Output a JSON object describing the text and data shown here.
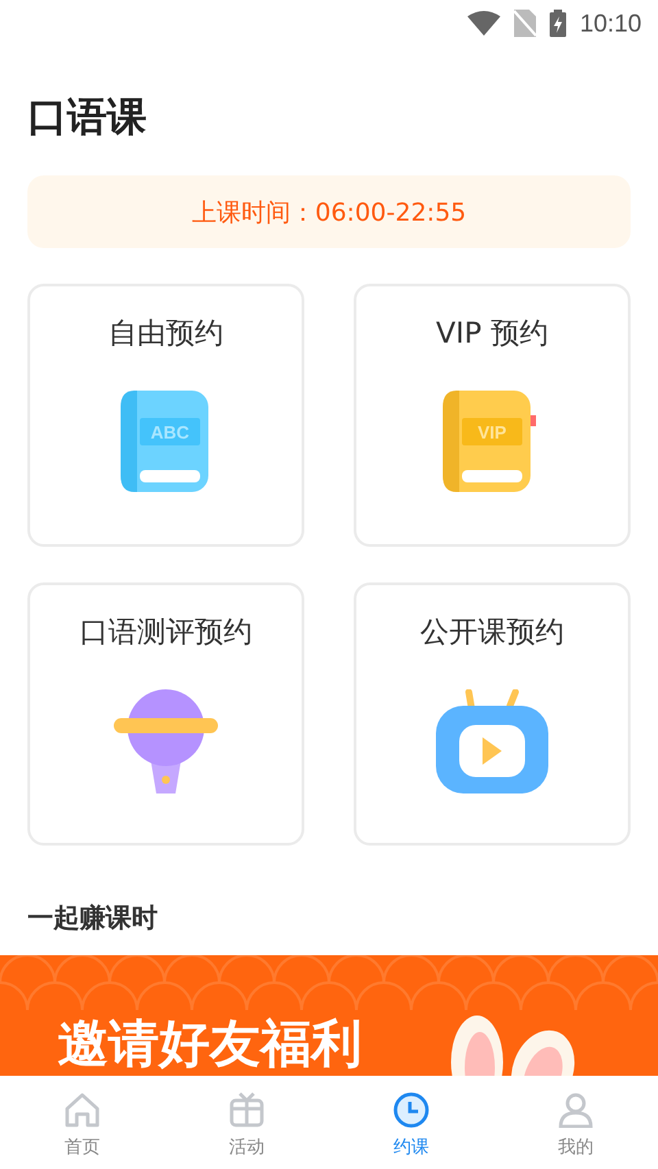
{
  "status_bar": {
    "time": "10:10"
  },
  "title": "口语课",
  "notice": "上课时间：06:00-22:55",
  "cards": [
    {
      "kind": "book",
      "label": "自由预约",
      "icon_text": "ABC"
    },
    {
      "kind": "vip_book",
      "label": "VIP 预约",
      "icon_text": "VIP"
    },
    {
      "kind": "lollipop",
      "label": "口语测评预约"
    },
    {
      "kind": "tv",
      "label": "公开课预约"
    }
  ],
  "section_title": "一起赚课时",
  "banner": {
    "text": "邀请好友福利"
  },
  "nav": [
    {
      "kind": "home",
      "label": "首页",
      "selected": false
    },
    {
      "kind": "gift",
      "label": "活动",
      "selected": false
    },
    {
      "kind": "clock",
      "label": "约课",
      "selected": true
    },
    {
      "kind": "person",
      "label": "我的",
      "selected": false
    }
  ]
}
